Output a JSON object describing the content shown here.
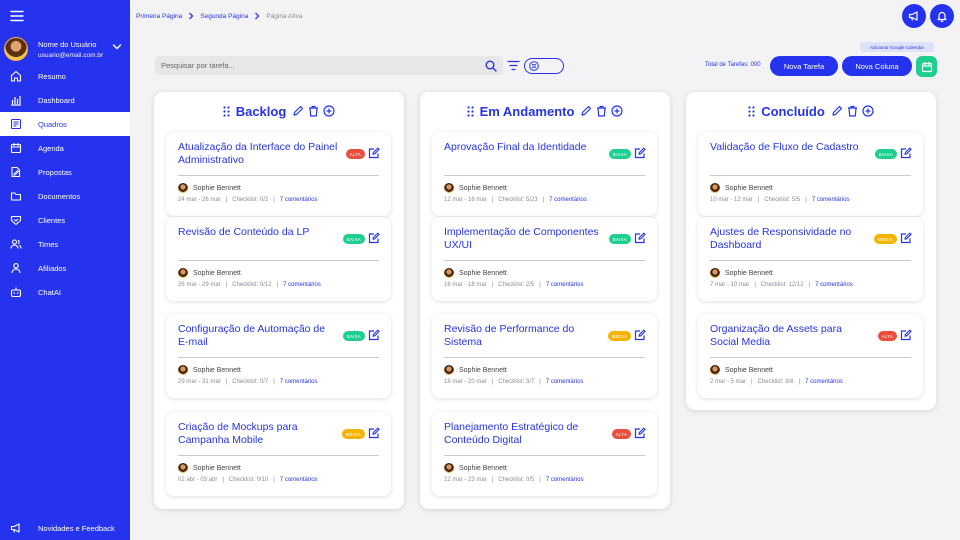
{
  "sidebar": {
    "user": {
      "name": "Nome do Usuário",
      "email": "usuario@email.com.br"
    },
    "items": [
      {
        "label": "Resumo",
        "icon": "home-icon"
      },
      {
        "label": "Dashboard",
        "icon": "bar-chart-icon"
      },
      {
        "label": "Quadros",
        "icon": "board-icon",
        "active": true
      },
      {
        "label": "Agenda",
        "icon": "calendar-icon"
      },
      {
        "label": "Propostas",
        "icon": "document-edit-icon"
      },
      {
        "label": "Documentos",
        "icon": "folder-icon"
      },
      {
        "label": "Clientes",
        "icon": "handshake-icon"
      },
      {
        "label": "Times",
        "icon": "users-icon"
      },
      {
        "label": "Afiliados",
        "icon": "user-icon"
      },
      {
        "label": "ChatAI",
        "icon": "robot-icon"
      }
    ],
    "footer_label": "Novidades e Feedback"
  },
  "breadcrumb": [
    "Primeira Página",
    "Segunda Página",
    "Página Ativa"
  ],
  "toolbar": {
    "google_calendar_label": "Adicionar Google Calendar",
    "search_placeholder": "Pesquisar por tarefa...",
    "total_label": "Total de Tarefas: 000",
    "new_task_label": "Nova Tarefa",
    "new_column_label": "Nova Coluna"
  },
  "colors": {
    "primary": "#2633ee",
    "alta": "#ea4e3d",
    "baixa": "#1ecf8f",
    "media": "#f6b300",
    "background": "#f3f3f5"
  },
  "columns": [
    {
      "title": "Backlog",
      "cards": [
        {
          "title": "Atualização da Interface do Painel Administrativo",
          "priority": "ALTA",
          "assignee": "Sophie Bennett",
          "dates": "24 mar - 26 mar",
          "checklist": "Checklist: 0/2",
          "comments": "7 comentários"
        },
        {
          "title": "Revisão de Conteúdo da LP",
          "priority": "BAIXA",
          "assignee": "Sophie Bennett",
          "dates": "26 mar - 29 mar",
          "checklist": "Checklist: 0/12",
          "comments": "7 comentários"
        },
        {
          "title": "Configuração de Automação de E-mail",
          "priority": "BAIXA",
          "assignee": "Sophie Bennett",
          "dates": "29 mar - 31 mar",
          "checklist": "Checklist: 0/7",
          "comments": "7 comentários"
        },
        {
          "title": "Criação de Mockups para Campanha Mobile",
          "priority": "MÉDIA",
          "assignee": "Sophie Bennett",
          "dates": "02 abr - 03 abr",
          "checklist": "Checklist: 0/10",
          "comments": "7 comentários"
        }
      ]
    },
    {
      "title": "Em Andamento",
      "cards": [
        {
          "title": "Aprovação Final da Identidade",
          "priority": "BAIXA",
          "assignee": "Sophie Bennett",
          "dates": "12 mar - 16 mar",
          "checklist": "Checklist: 5/23",
          "comments": "7 comentários"
        },
        {
          "title": "Implementação de Componentes UX/UI",
          "priority": "BAIXA",
          "assignee": "Sophie Bennett",
          "dates": "16 mar - 18 mar",
          "checklist": "Checklist: 2/5",
          "comments": "7 comentários"
        },
        {
          "title": "Revisão de Performance do Sistema",
          "priority": "MÉDIA",
          "assignee": "Sophie Bennett",
          "dates": "18 mar - 20 mar",
          "checklist": "Checklist: 3/7",
          "comments": "7 comentários"
        },
        {
          "title": "Planejamento Estratégico de Conteúdo Digital",
          "priority": "ALTA",
          "assignee": "Sophie Bennett",
          "dates": "22 mar - 23 mar",
          "checklist": "Checklist: 0/5",
          "comments": "7 comentários"
        }
      ]
    },
    {
      "title": "Concluído",
      "cards": [
        {
          "title": "Validação de Fluxo de Cadastro",
          "priority": "BAIXA",
          "assignee": "Sophie Bennett",
          "dates": "10 mar - 12 mar",
          "checklist": "Checklist: 5/5",
          "comments": "7 comentários"
        },
        {
          "title": "Ajustes de Responsividade no Dashboard",
          "priority": "MÉDIA",
          "assignee": "Sophie Bennett",
          "dates": "7 mar - 10 mar",
          "checklist": "Checklist: 12/12",
          "comments": "7 comentários"
        },
        {
          "title": "Organização de Assets para Social Media",
          "priority": "ALTA",
          "assignee": "Sophie Bennett",
          "dates": "2 mar - 5 mar",
          "checklist": "Checklist: 8/8",
          "comments": "7 comentários"
        }
      ]
    }
  ]
}
